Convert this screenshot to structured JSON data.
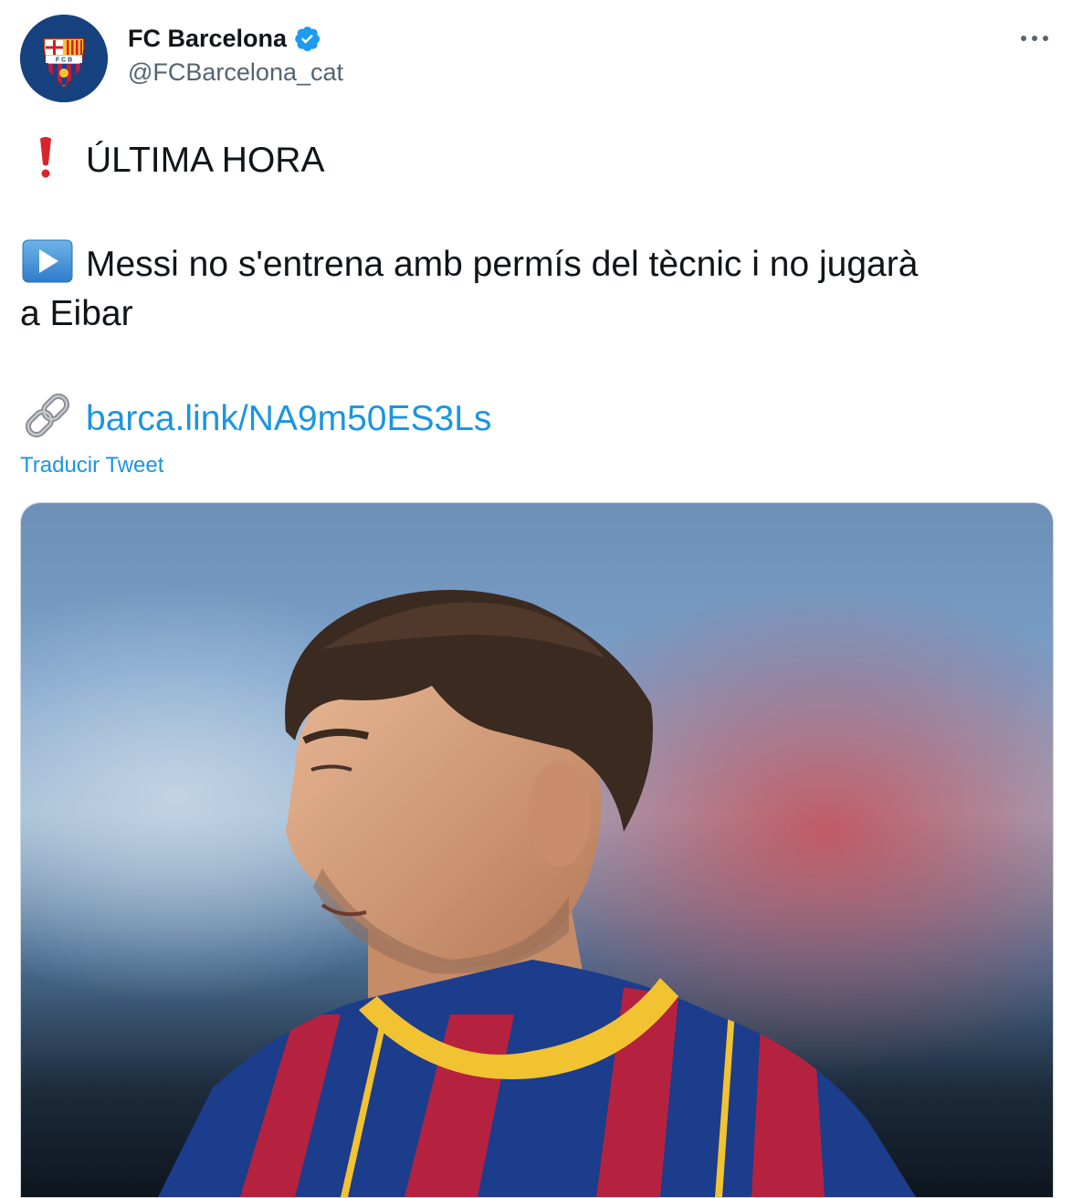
{
  "author": {
    "display_name": "FC Barcelona",
    "handle": "@FCBarcelona_cat",
    "avatar_icon": "fcb-crest-icon",
    "verified_icon": "verified-badge-icon"
  },
  "menu": {
    "more_label": "···"
  },
  "tweet": {
    "line1_icon": "red-exclamation-icon",
    "line1_text": "ÚLTIMA HORA",
    "line2_icon": "play-button-icon",
    "line2_text_a": "Messi no s'entrena amb permís del tècnic i no jugarà",
    "line2_text_b": "a Eibar",
    "link_icon": "link-icon",
    "link_text": "barca.link/NA9m50ES3Ls"
  },
  "translate_label": "Traducir Tweet",
  "media": {
    "description_icon": "player-photo"
  },
  "colors": {
    "accent": "#1b95e0",
    "verified": "#1d9bf0",
    "text": "#0f1419",
    "secondary": "#536471",
    "blaugrana_blue": "#1c3c8c",
    "blaugrana_red": "#b5223f",
    "gold": "#f1c232"
  }
}
